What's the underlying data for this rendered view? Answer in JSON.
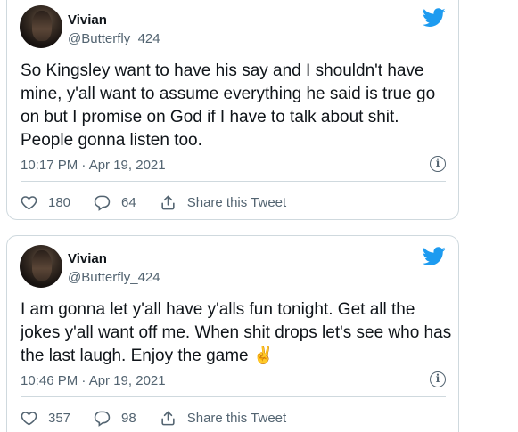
{
  "tweets": [
    {
      "name": "Vivian",
      "handle": "@Butterfly_424",
      "text": "So Kingsley want to have his say and I shouldn't have mine, y'all want to assume everything he said is true go on but I promise on God if I have to talk about shit. People gonna listen too.",
      "timestamp": "10:17 PM · Apr 19, 2021",
      "likes": "180",
      "replies": "64",
      "share_label": "Share this Tweet"
    },
    {
      "name": "Vivian",
      "handle": "@Butterfly_424",
      "text": "I am gonna let y'all have y'alls fun tonight. Get all the jokes y'all want off me. When shit drops let's see who has the last laugh. Enjoy the game ✌️",
      "timestamp": "10:46 PM · Apr 19, 2021",
      "likes": "357",
      "replies": "98",
      "share_label": "Share this Tweet"
    }
  ],
  "icons": {
    "brand": "twitter-bird-icon",
    "info": "info-icon",
    "like": "heart-icon",
    "reply": "reply-bubble-icon",
    "share": "share-icon"
  },
  "colors": {
    "brand_blue": "#1d9bf0",
    "secondary_text": "#536471",
    "border": "#cfd9de"
  }
}
